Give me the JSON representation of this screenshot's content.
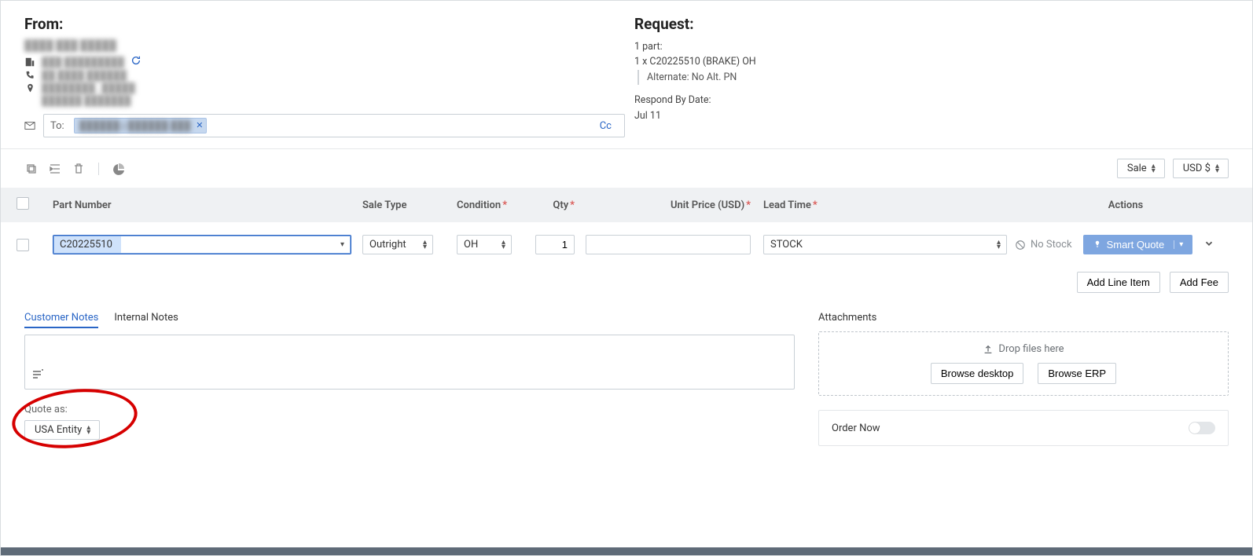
{
  "from": {
    "title": "From:",
    "name": "████ ███ █████",
    "company": "███ █████████",
    "phone": "██ ████ ██████",
    "city": "████████ , █████",
    "country": "██████ ███████",
    "email_intro_icon": "envelope",
    "to_label": "To:",
    "to_chip": "██████@██████.███",
    "cc": "Cc"
  },
  "request": {
    "title": "Request:",
    "summary": "1 part:",
    "line": "1 x C20225510 (BRAKE) OH",
    "alternate": "Alternate: No Alt. PN",
    "respond_label": "Respond By Date:",
    "respond_date": "Jul 11"
  },
  "toolbar": {
    "sale_btn": "Sale",
    "currency_btn": "USD $"
  },
  "table": {
    "headers": {
      "part": "Part Number",
      "saletype": "Sale Type",
      "condition": "Condition",
      "qty": "Qty",
      "unitprice": "Unit Price (USD)",
      "leadtime": "Lead Time",
      "actions": "Actions"
    },
    "row": {
      "part": "C20225510",
      "saletype": "Outright",
      "condition": "OH",
      "qty": "1",
      "unitprice": "",
      "leadtime": "STOCK",
      "nostock": "No Stock",
      "smart": "Smart Quote"
    },
    "add_line": "Add Line Item",
    "add_fee": "Add Fee"
  },
  "notes": {
    "tab_cust": "Customer Notes",
    "tab_int": "Internal Notes",
    "quote_as_label": "Quote as:",
    "quote_as_value": "USA Entity"
  },
  "attachments": {
    "title": "Attachments",
    "drop": "Drop files here",
    "browse_desktop": "Browse desktop",
    "browse_erp": "Browse ERP",
    "order_now": "Order Now"
  }
}
